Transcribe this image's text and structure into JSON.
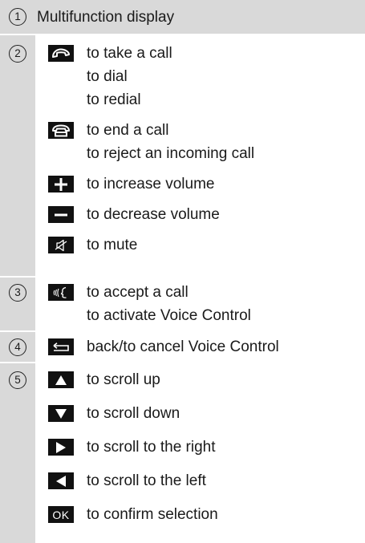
{
  "items": [
    {
      "number": "1",
      "title": "Multifunction display"
    },
    {
      "number": "2",
      "groups": [
        {
          "icon": "phone-pickup-icon",
          "lines": [
            "to take a call",
            "to dial",
            "to redial"
          ]
        },
        {
          "icon": "phone-hangup-icon",
          "lines": [
            "to end a call",
            "to reject an incoming call"
          ]
        },
        {
          "icon": "plus-icon",
          "lines": [
            "to increase volume"
          ]
        },
        {
          "icon": "minus-icon",
          "lines": [
            "to decrease volume"
          ]
        },
        {
          "icon": "mute-speaker-icon",
          "lines": [
            "to mute"
          ]
        }
      ]
    },
    {
      "number": "3",
      "groups": [
        {
          "icon": "voice-control-icon",
          "lines": [
            "to accept a call",
            "to activate Voice Control"
          ]
        }
      ]
    },
    {
      "number": "4",
      "groups": [
        {
          "icon": "back-arrow-icon",
          "lines": [
            "back/to cancel Voice Control"
          ]
        }
      ]
    },
    {
      "number": "5",
      "groups": [
        {
          "icon": "arrow-up-icon",
          "lines": [
            "to scroll up"
          ]
        },
        {
          "icon": "arrow-down-icon",
          "lines": [
            "to scroll down"
          ]
        },
        {
          "icon": "arrow-right-icon",
          "lines": [
            "to scroll to the right"
          ]
        },
        {
          "icon": "arrow-left-icon",
          "lines": [
            "to scroll to the left"
          ]
        },
        {
          "icon": "ok-key-icon",
          "label": "OK",
          "lines": [
            "to confirm selection"
          ]
        }
      ]
    }
  ]
}
